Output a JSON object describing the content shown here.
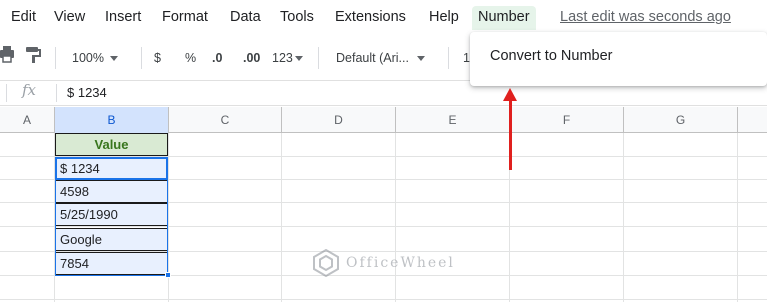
{
  "menu": {
    "items": [
      "Edit",
      "View",
      "Insert",
      "Format",
      "Data",
      "Tools",
      "Extensions",
      "Help",
      "Number"
    ],
    "last_edit": "Last edit was seconds ago"
  },
  "toolbar": {
    "zoom": "100%",
    "currency": "$",
    "percent": "%",
    "decrease_decimal": ".0",
    "increase_decimal": ".00",
    "more_formats": "123",
    "font": "Default (Ari...",
    "font_size_partial": "1"
  },
  "formula_bar": {
    "fx_label": "fx",
    "value": "$ 1234"
  },
  "columns": [
    "A",
    "B",
    "C",
    "D",
    "E",
    "F",
    "G"
  ],
  "table": {
    "header": "Value",
    "rows": [
      "$ 1234",
      "4598",
      "5/25/1990",
      "Google",
      "7854"
    ]
  },
  "dropdown": {
    "item": "Convert to Number"
  },
  "watermark": {
    "text": "OfficeWheel"
  },
  "colors": {
    "accent": "#1a73e8",
    "header_fill": "#d9ead3",
    "header_text": "#38761d",
    "selection_fill": "#e8f0fe",
    "arrow": "#e0201e"
  }
}
